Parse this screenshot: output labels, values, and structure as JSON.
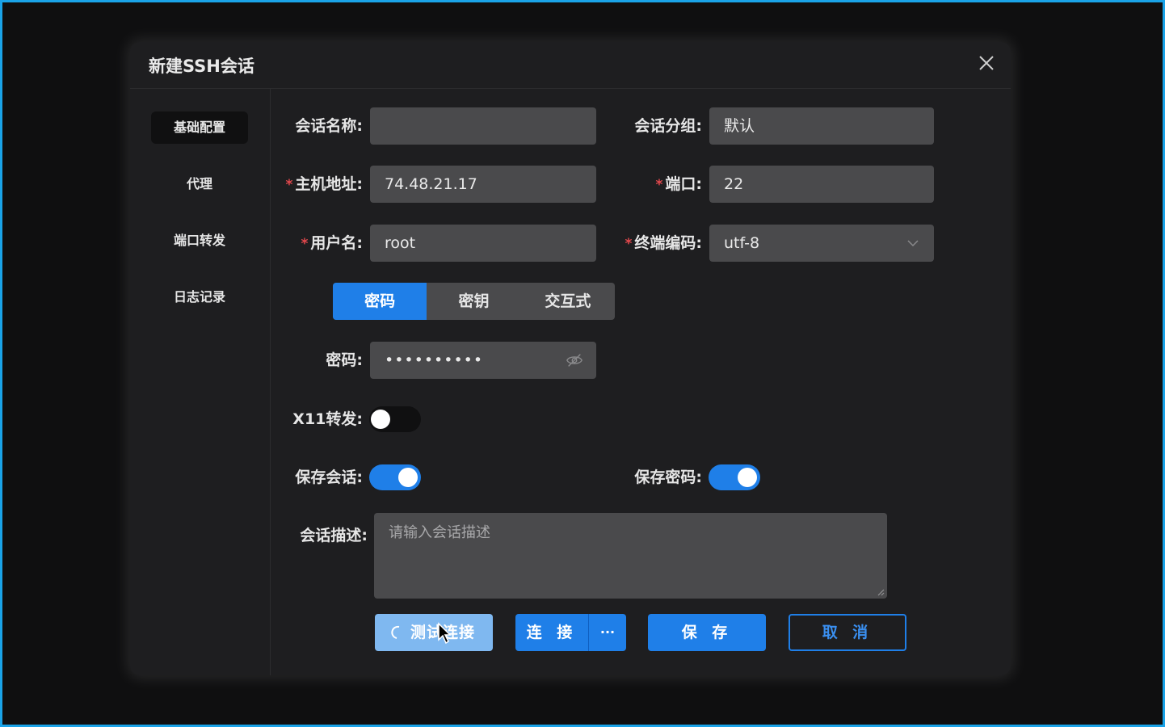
{
  "dialog": {
    "title": "新建SSH会话"
  },
  "sidebar": {
    "items": [
      {
        "label": "基础配置"
      },
      {
        "label": "代理"
      },
      {
        "label": "端口转发"
      },
      {
        "label": "日志记录"
      }
    ]
  },
  "form": {
    "session_name": {
      "label": "会话名称:",
      "value": ""
    },
    "session_group": {
      "label": "会话分组:",
      "value": "默认"
    },
    "host": {
      "label": "主机地址:",
      "value": "74.48.21.17",
      "required": true
    },
    "port": {
      "label": "端口:",
      "value": "22",
      "required": true
    },
    "username": {
      "label": "用户名:",
      "value": "root",
      "required": true
    },
    "encoding": {
      "label": "终端编码:",
      "value": "utf-8",
      "required": true
    },
    "auth_tabs": [
      {
        "label": "密码"
      },
      {
        "label": "密钥"
      },
      {
        "label": "交互式"
      }
    ],
    "password": {
      "label": "密码:",
      "value": "••••••••••"
    },
    "x11": {
      "label": "X11转发:",
      "on": false
    },
    "save_session": {
      "label": "保存会话:",
      "on": true
    },
    "save_password": {
      "label": "保存密码:",
      "on": true
    },
    "description": {
      "label": "会话描述:",
      "placeholder": "请输入会话描述"
    }
  },
  "buttons": {
    "test": "测试连接",
    "connect": "连 接",
    "connect_more": "···",
    "save": "保 存",
    "cancel": "取 消"
  },
  "colors": {
    "accent": "#1f7fe8",
    "frame": "#1aa3e8",
    "required": "#e5484d"
  }
}
